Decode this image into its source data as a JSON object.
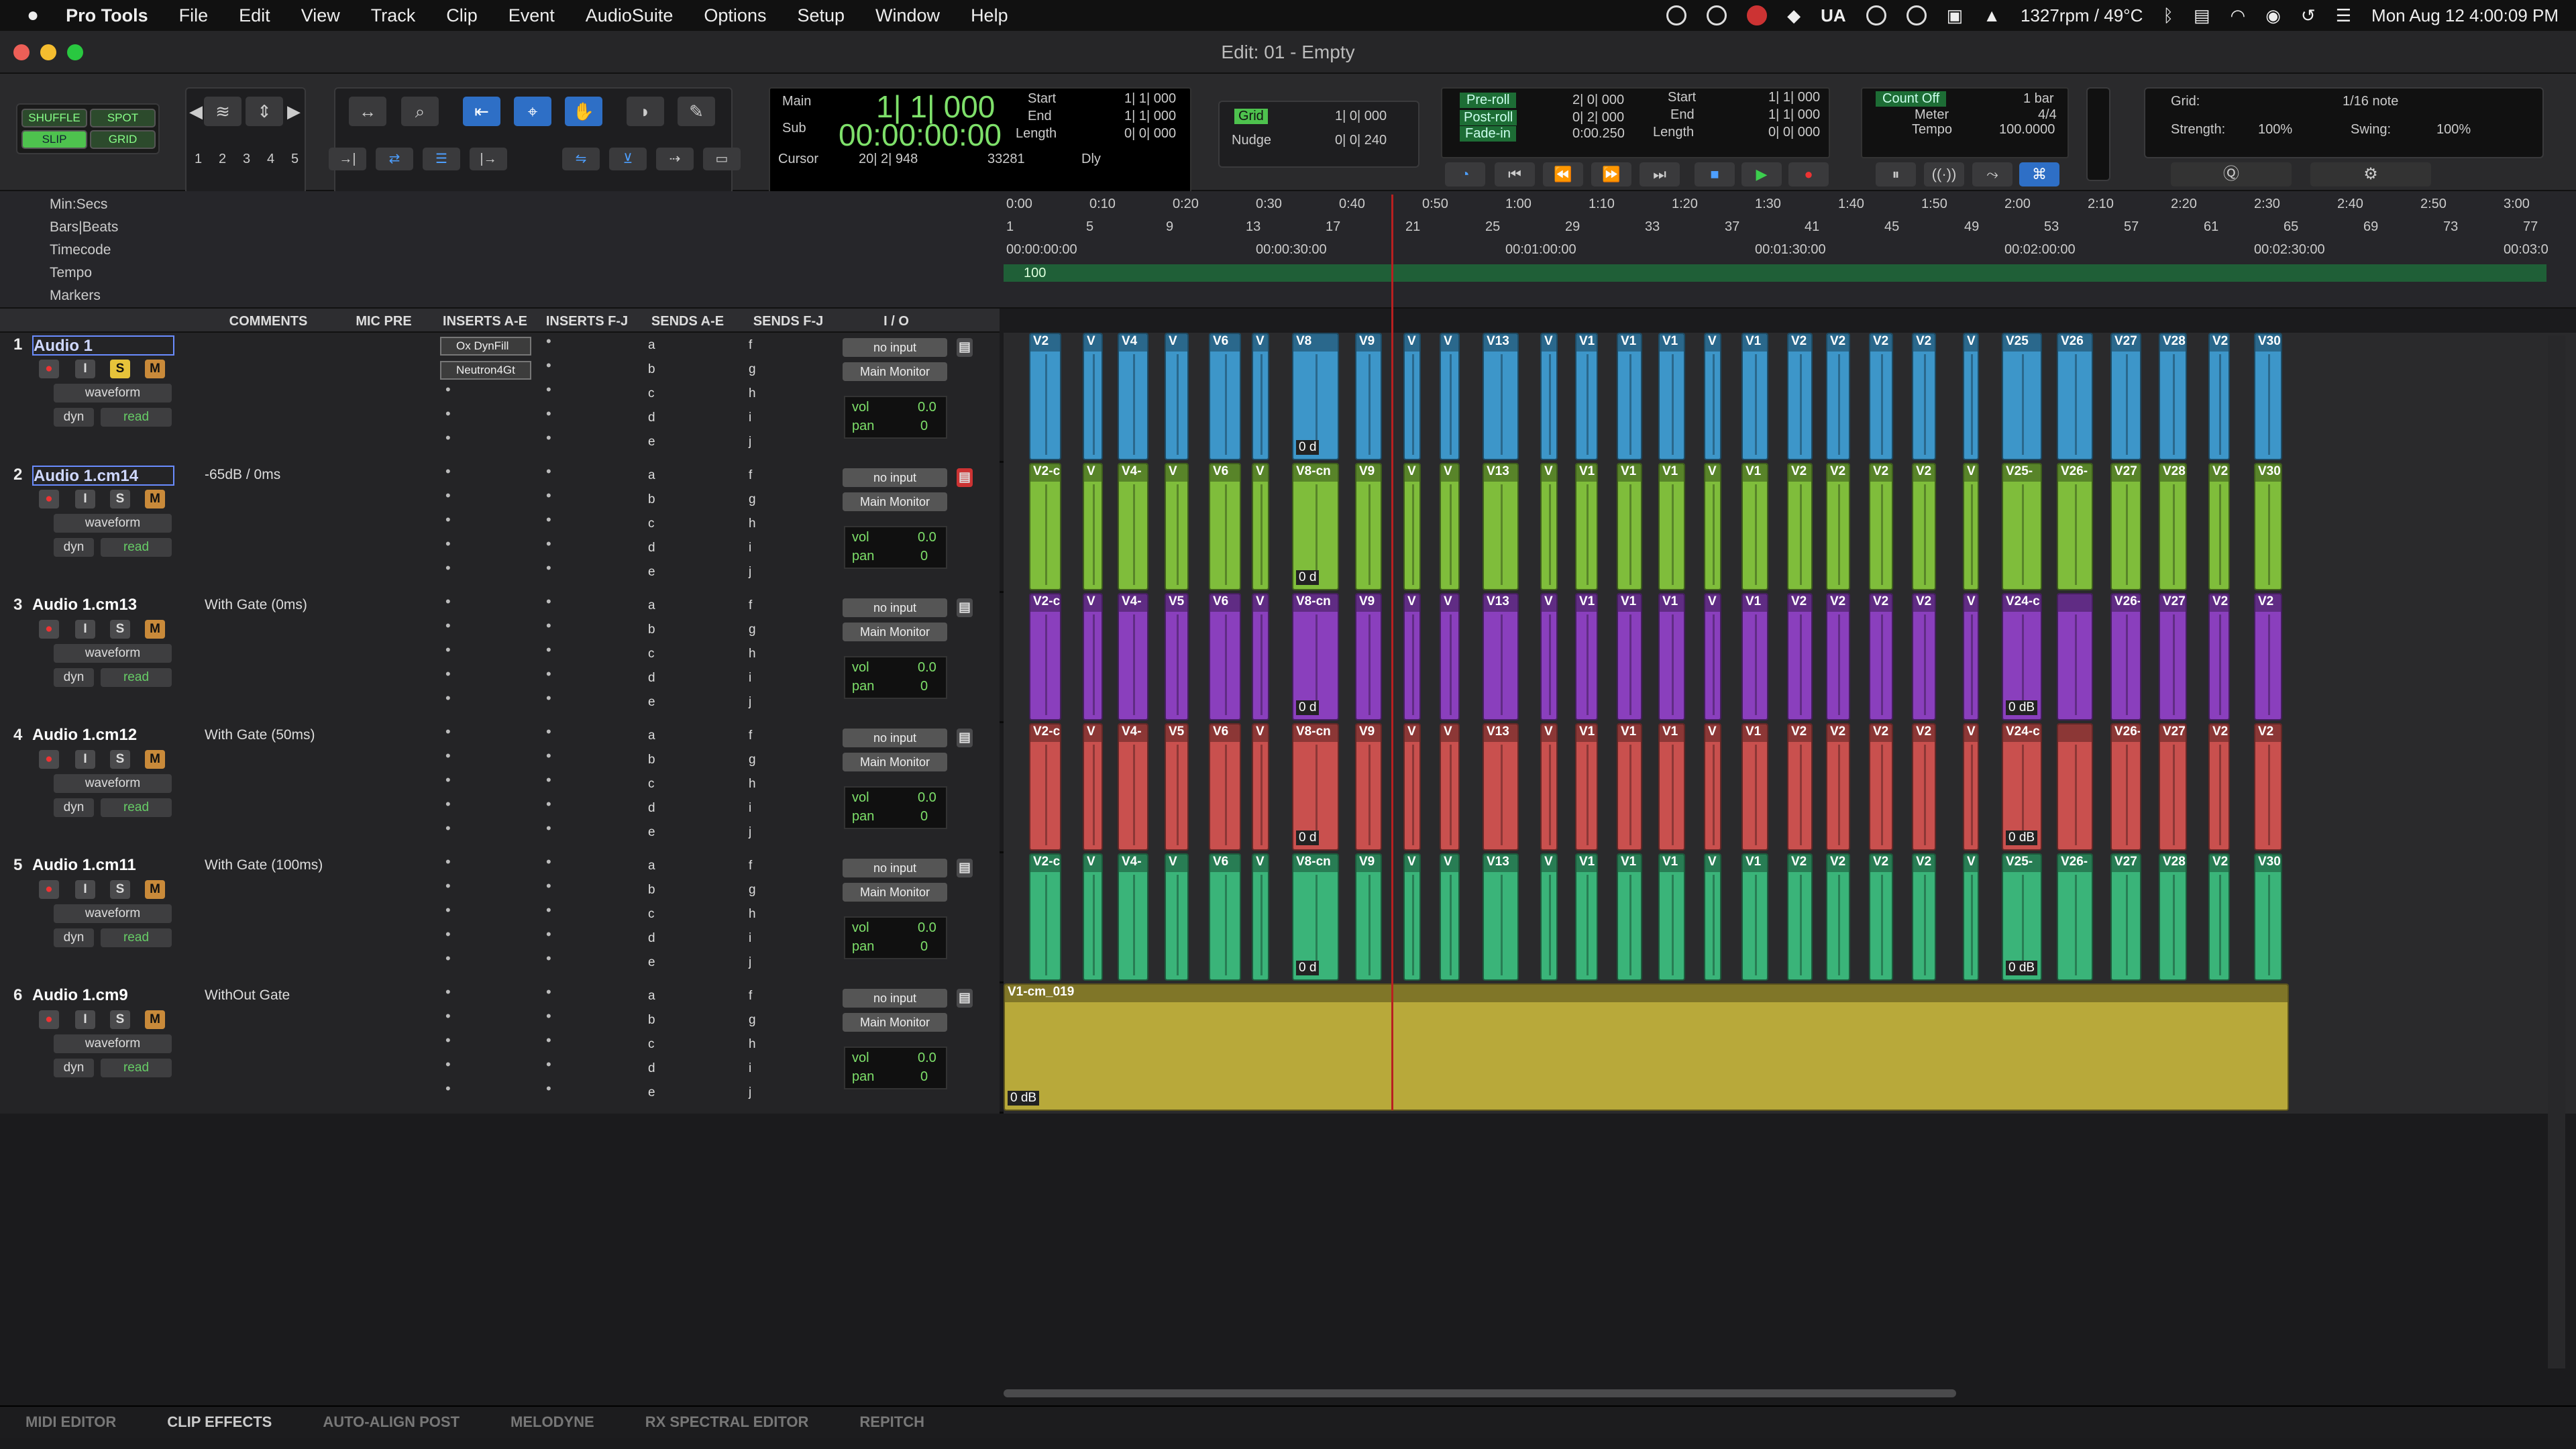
{
  "menubar": {
    "app": "Pro Tools",
    "items": [
      "File",
      "Edit",
      "View",
      "Track",
      "Clip",
      "Event",
      "AudioSuite",
      "Options",
      "Setup",
      "Window",
      "Help"
    ],
    "status": {
      "ua": "UA",
      "cpu": "1327rpm / 49°C",
      "datetime": "Mon Aug 12  4:00:09 PM"
    }
  },
  "window": {
    "title": "Edit: 01 - Empty"
  },
  "modes": {
    "shuffle": "SHUFFLE",
    "spot": "SPOT",
    "slip": "SLIP",
    "grid": "GRID"
  },
  "zoom_presets": [
    "1",
    "2",
    "3",
    "4",
    "5"
  ],
  "counter": {
    "main_label": "Main",
    "main": "1| 1| 000",
    "sub_label": "Sub",
    "sub": "00:00:00:00",
    "start_label": "Start",
    "start": "1| 1| 000",
    "end_label": "End",
    "end": "1| 1| 000",
    "length_label": "Length",
    "length": "0| 0| 000",
    "cursor_label": "Cursor",
    "cursor": "20| 2| 948",
    "sample": "33281",
    "dly": "Dly"
  },
  "grid": {
    "grid_label": "Grid",
    "grid_value": "1| 0| 000",
    "nudge_label": "Nudge",
    "nudge_value": "0| 0| 240"
  },
  "transport": {
    "preroll_label": "Pre-roll",
    "preroll": "2| 0| 000",
    "postroll_label": "Post-roll",
    "postroll": "0| 2| 000",
    "fadein_label": "Fade-in",
    "fadein": "0:00.250",
    "start_label": "Start",
    "start": "1| 1| 000",
    "end_label": "End",
    "end": "1| 1| 000",
    "length_label": "Length",
    "length": "0| 0| 000"
  },
  "countoff": {
    "count_label": "Count Off",
    "count_value": "1 bar",
    "meter_label": "Meter",
    "meter_value": "4/4",
    "tempo_label": "Tempo",
    "tempo_value": "100.0000"
  },
  "quantize": {
    "grid_label": "Grid:",
    "grid_value": "1/16 note",
    "strength_label": "Strength:",
    "strength": "100%",
    "swing_label": "Swing:",
    "swing": "100%"
  },
  "rulers": {
    "minsecs": "Min:Secs",
    "bars": "Bars|Beats",
    "timecode": "Timecode",
    "tempo": "Tempo",
    "markers": "Markers",
    "minsecs_ticks": [
      "0:00",
      "0:10",
      "0:20",
      "0:30",
      "0:40",
      "0:50",
      "1:00",
      "1:10",
      "1:20",
      "1:30",
      "1:40",
      "1:50",
      "2:00",
      "2:10",
      "2:20",
      "2:30",
      "2:40",
      "2:50",
      "3:00"
    ],
    "bars_ticks": [
      "1",
      "5",
      "9",
      "13",
      "17",
      "21",
      "25",
      "29",
      "33",
      "37",
      "41",
      "45",
      "49",
      "53",
      "57",
      "61",
      "65",
      "69",
      "73",
      "77"
    ],
    "tc_ticks": [
      "00:00:00:00",
      "00:00:30:00",
      "00:01:00:00",
      "00:01:30:00",
      "00:02:00:00",
      "00:02:30:00",
      "00:03:0"
    ],
    "tempo_marker": "100"
  },
  "columns": [
    "COMMENTS",
    "MIC PRE",
    "INSERTS A-E",
    "INSERTS F-J",
    "SENDS A-E",
    "SENDS F-J",
    "I / O"
  ],
  "track_common": {
    "rec": "●",
    "input": "I",
    "solo": "S",
    "mute": "M",
    "view": "waveform",
    "dyn": "dyn",
    "auto": "read",
    "io_in": "no input",
    "io_out": "Main Monitor",
    "vol_label": "vol",
    "vol": "0.0",
    "pan_label": "pan",
    "pan": "0",
    "sends_ae": [
      "a",
      "b",
      "c",
      "d",
      "e"
    ],
    "sends_fj": [
      "f",
      "g",
      "h",
      "i",
      "j"
    ]
  },
  "tracks": [
    {
      "num": "1",
      "name": "Audio 1",
      "comment": "",
      "color": "#3d96c9",
      "inserts": [
        "Ox DynFill",
        "Neutron4Gt"
      ],
      "tag": "0 d",
      "tag2": ""
    },
    {
      "num": "2",
      "name": "Audio 1.cm14",
      "comment": "-65dB / 0ms",
      "color": "#7fbd3b",
      "inserts": [],
      "tag": "0 d",
      "tag2": ""
    },
    {
      "num": "3",
      "name": "Audio 1.cm13",
      "comment": "With Gate (0ms)",
      "color": "#8a3fbd",
      "inserts": [],
      "tag": "0 d",
      "tag2": "0 dB"
    },
    {
      "num": "4",
      "name": "Audio 1.cm12",
      "comment": "With Gate (50ms)",
      "color": "#c9504e",
      "inserts": [],
      "tag": "0 d",
      "tag2": "0 dB"
    },
    {
      "num": "5",
      "name": "Audio 1.cm11",
      "comment": "With Gate (100ms)",
      "color": "#3ab479",
      "inserts": [],
      "tag": "0 d",
      "tag2": "0 dB"
    },
    {
      "num": "6",
      "name": "Audio 1.cm9",
      "comment": "WithOut Gate",
      "color": "#b8a93a",
      "inserts": [],
      "tag": "0 dB",
      "tag2": ""
    }
  ],
  "clip_labels": {
    "t1": [
      "V2",
      "V",
      "V4",
      "V",
      "V6",
      "V",
      "V8",
      "V9",
      "V",
      "V",
      "V13",
      "V",
      "V1",
      "V1",
      "V1",
      "V",
      "V1",
      "V2",
      "V2",
      "V2",
      "V2",
      "V",
      "V25",
      "V26",
      "V27",
      "V28",
      "V2",
      "V30"
    ],
    "t2": [
      "V2-c",
      "V",
      "V4-",
      "V",
      "V6",
      "V",
      "V8-cn",
      "V9",
      "V",
      "V",
      "V13",
      "V",
      "V1",
      "V1",
      "V1",
      "V",
      "V1",
      "V2",
      "V2",
      "V2",
      "V2",
      "V",
      "V25-",
      "V26-",
      "V27",
      "V28",
      "V2",
      "V30"
    ],
    "t3": [
      "V2-c",
      "V",
      "V4-",
      "V5",
      "V6",
      "V",
      "V8-cn",
      "V9",
      "V",
      "V",
      "V13",
      "V",
      "V1",
      "V1",
      "V1",
      "V",
      "V1",
      "V2",
      "V2",
      "V2",
      "V2",
      "V",
      "V24-cm_0",
      "",
      "V26-",
      "V27",
      "V28",
      "V2",
      "V30"
    ],
    "t6": [
      "V1-cm_019"
    ]
  },
  "bottom_tabs": [
    "MIDI EDITOR",
    "CLIP EFFECTS",
    "AUTO-ALIGN POST",
    "MELODYNE",
    "RX SPECTRAL EDITOR",
    "REPITCH"
  ]
}
